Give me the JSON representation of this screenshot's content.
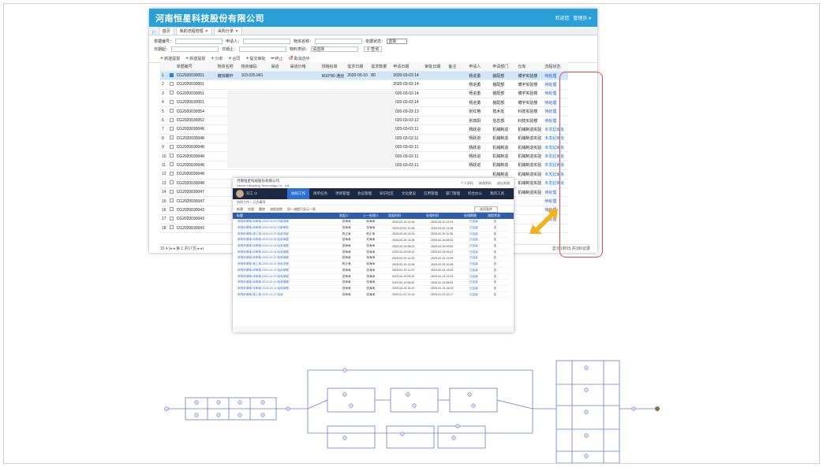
{
  "window": {
    "brand": "河南恒星科技股份有限公司",
    "user_label": "欢迎您",
    "user_name": "管理员"
  },
  "tabs": [
    {
      "label": "首页"
    },
    {
      "label": "我的流程管理"
    },
    {
      "label": "采购分单"
    }
  ],
  "filters": {
    "order_no": "单据编号：",
    "applicant": "申请人：",
    "material_name": "物资名称：",
    "status": "单据状态：",
    "status_value": "选择",
    "date_start": "日期起：",
    "date_end": "日期止：",
    "material_type": "物料类别：",
    "material_type_value": "请选择",
    "search": "查询"
  },
  "toolbar": [
    {
      "icon": "plus",
      "label": "新建提报"
    },
    {
      "icon": "plus",
      "label": "新建提报"
    },
    {
      "icon": "plus",
      "label": "分单"
    },
    {
      "icon": "plus",
      "label": "合同"
    },
    {
      "icon": "plus",
      "label": "提交审批"
    },
    {
      "icon": "minus",
      "label": "终止"
    },
    {
      "icon": "undo",
      "label": "取消选中"
    }
  ],
  "columns": [
    "单据编号",
    "物资名称",
    "物资编码",
    "渠道",
    "渠道价格",
    "规格标准",
    "需求日期",
    "需求数量",
    "申请日期",
    "审批日期",
    "备注",
    "申请人",
    "申请部门",
    "仓库",
    "流程状态"
  ],
  "rows": [
    {
      "n": "1",
      "id": "CG2020030051",
      "name": "镀锌螺杆",
      "code": "103.025.041",
      "spec": "M10*80 通丝",
      "need_date": "2020-03-10",
      "qty": "80",
      "apply_date": "2020-03-03 14",
      "applicant": "杨进勇",
      "dept": "装配部",
      "warehouse": "博宇实验楼",
      "status": "待处理",
      "kind": "pending"
    },
    {
      "n": "2",
      "id": "CG2020030051",
      "name": "",
      "code": "",
      "spec": "",
      "need_date": "",
      "qty": "",
      "apply_date": "2020-03-03 14",
      "applicant": "杨进勇",
      "dept": "装配部",
      "warehouse": "博宇实验楼",
      "status": "待处理",
      "kind": "pending"
    },
    {
      "n": "3",
      "id": "CG2020030051",
      "name": "",
      "code": "",
      "spec": "",
      "need_date": "",
      "qty": "",
      "apply_date": "2020-03-03 14",
      "applicant": "杨进勇",
      "dept": "装配部",
      "warehouse": "博宇实验楼",
      "status": "待处理",
      "kind": "pending"
    },
    {
      "n": "4",
      "id": "CG2020030051",
      "name": "",
      "code": "",
      "spec": "",
      "need_date": "",
      "qty": "",
      "apply_date": "2020-03-03 14",
      "applicant": "杨进勇",
      "dept": "装配部",
      "warehouse": "博宇实验楼",
      "status": "待处理",
      "kind": "pending"
    },
    {
      "n": "5",
      "id": "CG2020030054",
      "name": "",
      "code": "",
      "spec": "",
      "need_date": "",
      "qty": "",
      "apply_date": "2020-03-03 13",
      "applicant": "张红艳",
      "dept": "技术处",
      "warehouse": "科技实验楼",
      "status": "待处理",
      "kind": "pending"
    },
    {
      "n": "6",
      "id": "CG2020030052",
      "name": "",
      "code": "",
      "spec": "",
      "need_date": "",
      "qty": "",
      "apply_date": "2020-03-03 12",
      "applicant": "张高阳",
      "dept": "信息部",
      "warehouse": "科技实验楼",
      "status": "待处理",
      "kind": "pending"
    },
    {
      "n": "7",
      "id": "CG2020030048",
      "name": "",
      "code": "",
      "spec": "",
      "need_date": "",
      "qty": "",
      "apply_date": "2020-03-03 11",
      "applicant": "杨跃进",
      "dept": "机械制造",
      "warehouse": "机械制造实验",
      "status": "未发起审批",
      "kind": "unsent"
    },
    {
      "n": "8",
      "id": "CG2020030048",
      "name": "",
      "code": "",
      "spec": "",
      "need_date": "",
      "qty": "",
      "apply_date": "2020-03-03 11",
      "applicant": "杨跃进",
      "dept": "机械制造",
      "warehouse": "机械制造实验",
      "status": "未发起审批",
      "kind": "unsent"
    },
    {
      "n": "9",
      "id": "CG2020030048",
      "name": "",
      "code": "",
      "spec": "",
      "need_date": "",
      "qty": "",
      "apply_date": "2020-03-03 11",
      "applicant": "杨跃进",
      "dept": "机械制造",
      "warehouse": "机械制造实验",
      "status": "未发起审批",
      "kind": "unsent"
    },
    {
      "n": "10",
      "id": "CG2020030048",
      "name": "",
      "code": "",
      "spec": "",
      "need_date": "",
      "qty": "",
      "apply_date": "2020-03-03 11",
      "applicant": "杨跃进",
      "dept": "机械制造",
      "warehouse": "机械制造实验",
      "status": "未发起审批",
      "kind": "unsent"
    },
    {
      "n": "11",
      "id": "CG2020030048",
      "name": "",
      "code": "",
      "spec": "",
      "need_date": "",
      "qty": "",
      "apply_date": "2020-03-03 11",
      "applicant": "杨跃进",
      "dept": "机械制造",
      "warehouse": "机械制造实验",
      "status": "未发起审批",
      "kind": "unsent"
    },
    {
      "n": "12",
      "id": "CG2020030048",
      "name": "",
      "code": "",
      "spec": "",
      "need_date": "",
      "qty": "",
      "apply_date": "",
      "applicant": "",
      "dept": "机械制造",
      "warehouse": "机械制造实验",
      "status": "未发起审批",
      "kind": "unsent"
    },
    {
      "n": "13",
      "id": "CG2020030048",
      "name": "",
      "code": "",
      "spec": "",
      "need_date": "",
      "qty": "",
      "apply_date": "",
      "applicant": "",
      "dept": "机械制造",
      "warehouse": "机械制造实验",
      "status": "未发起审批",
      "kind": "unsent"
    },
    {
      "n": "14",
      "id": "CG2020030047",
      "name": "",
      "code": "",
      "spec": "",
      "need_date": "",
      "qty": "",
      "apply_date": "",
      "applicant": "",
      "dept": "金刚线设备",
      "warehouse": "机械制造实验",
      "status": "待处理",
      "kind": "pending"
    },
    {
      "n": "15",
      "id": "CG2020030047",
      "name": "",
      "code": "",
      "spec": "",
      "need_date": "",
      "qty": "",
      "apply_date": "",
      "applicant": "",
      "dept": "金刚线设备",
      "warehouse": "",
      "status": "待处理",
      "kind": "pending"
    },
    {
      "n": "16",
      "id": "CG2020030043",
      "name": "",
      "code": "",
      "spec": "",
      "need_date": "",
      "qty": "",
      "apply_date": "",
      "applicant": "",
      "dept": "",
      "warehouse": "",
      "status": "待处理",
      "kind": "pending"
    },
    {
      "n": "17",
      "id": "CG2020030043",
      "name": "",
      "code": "",
      "spec": "",
      "need_date": "",
      "qty": "",
      "apply_date": "",
      "applicant": "",
      "dept": "",
      "warehouse": "",
      "status": "待处理",
      "kind": "pending"
    },
    {
      "n": "18",
      "id": "CG2020030043",
      "name": "",
      "code": "",
      "spec": "",
      "need_date": "",
      "qty": "",
      "apply_date": "",
      "applicant": "",
      "dept": "",
      "warehouse": "",
      "status": "",
      "kind": "pending"
    }
  ],
  "pager": {
    "left": "15 ▾  |◂  ◂  第 1  共17页  ▸  ▸|",
    "right": "显示1到15,共186记录"
  },
  "portal": {
    "company": "河南恒星科技股份有限公司",
    "company_en": "Henan Hengxing Technology Co., Ltd.",
    "links": [
      "个人资料",
      "修改密码",
      "退出系统"
    ],
    "user": "刘工 ⏻",
    "menu": [
      "协同工作",
      "简单任务",
      "项目管理",
      "会议管理",
      "知识社区",
      "文化建设",
      "信用管理",
      "部门管理",
      "综合办公",
      "我的工具"
    ],
    "crumb": "协同工作 > 已办事项",
    "tools": [
      "新建",
      "办理",
      "删除",
      "流程追踪",
      "同一流程只显示一条"
    ],
    "filter": "选项条件",
    "head": [
      "标题",
      "发起人",
      "上一处理人",
      "发起时间",
      "处理时间",
      "处理期限",
      "流程状态"
    ],
    "rows": [
      [
        "采购申请单-待审核-2020-03-09 付款流程",
        "张海涛",
        "徐海涛",
        "2020-03-10 13:16",
        "2020-03-10 13:23",
        "已结束",
        "无"
      ],
      [
        "采购申请单-待审核-2020-03-02 付款审批",
        "张海涛",
        "张海涛",
        "2020-03-02 12:38",
        "2020-03-02 13:36",
        "已结束",
        "无"
      ],
      [
        "采购申请单-施工单-2020-02-29 验收流程",
        "陈正海",
        "陈正海",
        "2020-02-28 13:24",
        "2020-02-29 11:36",
        "已结束",
        "无"
      ],
      [
        "采购申请单-待审核-2020-02-26 验收单据",
        "张海涛",
        "刘海涛",
        "2020-02-25 14:36",
        "2020-02-26 08:32",
        "已结束",
        "无"
      ],
      [
        "采购申请单-待审核-2020-02-24 验收单据",
        "张海涛",
        "张海涛",
        "2020-02-24 08:32",
        "2020-02-24 09:52",
        "已结束",
        "无"
      ],
      [
        "采购申请单-待审核-2020-02-24 验收单据",
        "张海涛",
        "张海涛",
        "2020-02-23 09:12",
        "2020-02-24 09:22",
        "已结束",
        "无"
      ],
      [
        "采购申请单-待审核-2020-02-24 验收单据",
        "张海涛",
        "张海涛",
        "2020-02-19 11:23",
        "2020-02-24 13:09",
        "已结束",
        "无"
      ],
      [
        "采购申请单-施工单-2020-02-21 验收流程",
        "陈正海",
        "徐海涛",
        "2020-02-19 13:36",
        "2020-02-24 10:48",
        "已结束",
        "无"
      ],
      [
        "采购申请单-待审核-2020-02-24 验收单据",
        "张海涛",
        "张海涛",
        "2020-02-19 11:23",
        "2020-02-24 13:09",
        "已结束",
        "无"
      ],
      [
        "采购申请单-待审核-2020-02-19 验收单据",
        "张海涛",
        "张海涛",
        "2020-02-19 09:32",
        "2020-02-19 13:23",
        "已结束",
        "无"
      ],
      [
        "采购申请单-待审核-2020-02-19 验收单据",
        "张海涛",
        "张海涛",
        "2020-02-19 08:52",
        "2020-02-19 08:52",
        "已结束",
        "无"
      ],
      [
        "采购申请单-待审核-2020-02-14 验收单据",
        "张海涛",
        "张海涛",
        "2020-02-14 15:22",
        "2020-02-14 15:23",
        "已结束",
        "无"
      ],
      [
        "采购申请单-施工单-2020-01-22 验收",
        "张海涛",
        "张海涛",
        "2020-01-22 12:14",
        "2020-01-22 12:17",
        "已结束",
        "无"
      ]
    ]
  },
  "colors": {
    "header_blue": "#2a9fd8",
    "status_blue": "#1a56d6",
    "highlight_red": "#e34b4b",
    "arrow_yellow": "#f2b21c",
    "portal_nav": "#1c2742"
  }
}
